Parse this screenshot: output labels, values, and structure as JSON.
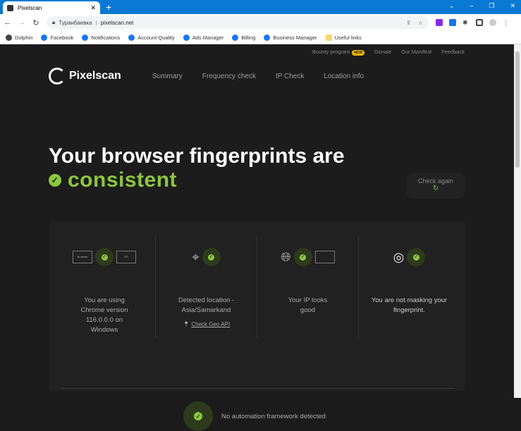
{
  "browser": {
    "tab_title": "Pixelscan",
    "address_location": "Туранбаевка",
    "url": "pixelscan.net",
    "bookmarks": [
      "Dolphin",
      "Facebook",
      "Notifications",
      "Account Quality",
      "Ads Manager",
      "Billing",
      "Business Manager",
      "Useful links"
    ]
  },
  "site": {
    "top_nav": {
      "bounty": "Bounty program",
      "new_badge": "NEW",
      "donate": "Donate",
      "manifest": "Our Manifest",
      "feedback": "Feedback"
    },
    "logo": "Pixelscan",
    "main_nav": [
      "Summary",
      "Frequency check",
      "IP Check",
      "Location info"
    ],
    "hero_line1": "Your browser fingerprints are",
    "hero_line2": "consistent",
    "check_again": "Check again",
    "checks": [
      {
        "label_browser": "Browser",
        "label_os": "OS",
        "text": "You are using Chrome version 116.0.0.0 on Windows"
      },
      {
        "text": "Detected location - Asia/Samarkand",
        "link": "Check Geo API"
      },
      {
        "text": "Your IP looks good"
      },
      {
        "text": "You are not masking your fingerprint."
      }
    ],
    "automation": "No automation framework detected",
    "accent": "#8dc63f"
  }
}
